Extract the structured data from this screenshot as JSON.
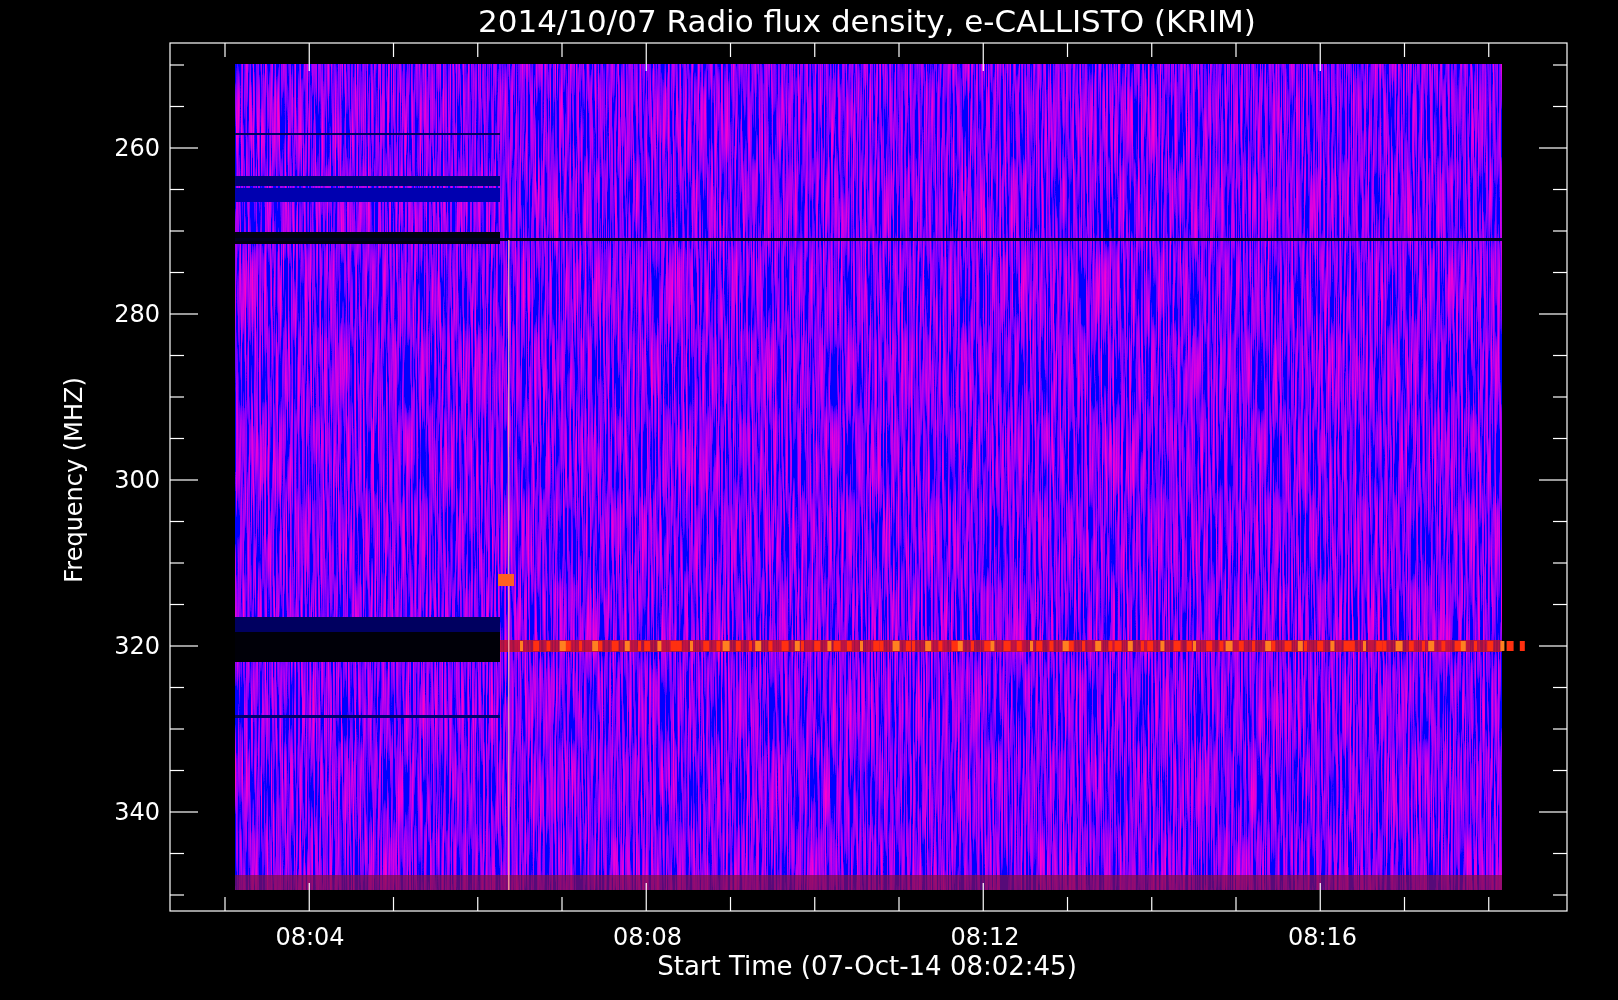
{
  "title": "2014/10/07  Radio flux density, e-CALLISTO (KRIM)",
  "y_axis": {
    "label": "Frequency (MHZ)",
    "ticks": [
      "260",
      "280",
      "300",
      "320",
      "340"
    ]
  },
  "x_axis": {
    "label": "Start Time (07-Oct-14 08:02:45)",
    "ticks": [
      "08:04",
      "08:08",
      "08:12",
      "08:16"
    ]
  }
}
